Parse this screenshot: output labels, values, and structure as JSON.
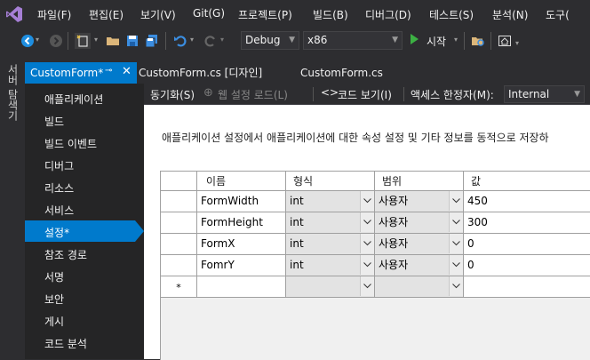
{
  "menu": [
    "파일(F)",
    "편집(E)",
    "보기(V)",
    "Git(G)",
    "프로젝트(P)",
    "빌드(B)",
    "디버그(D)",
    "테스트(S)",
    "분석(N)",
    "도구("
  ],
  "toolbar": {
    "config": "Debug",
    "platform": "x86",
    "start_label": "시작"
  },
  "server_explorer": "서버 탐색기",
  "tabs": {
    "active": "CustomForm*",
    "designer": "CustomForm.cs [디자인]",
    "code": "CustomForm.cs"
  },
  "nav": [
    "애플리케이션",
    "빌드",
    "빌드 이벤트",
    "디버그",
    "리소스",
    "서비스",
    "설정*",
    "참조 경로",
    "서명",
    "보안",
    "게시",
    "코드 분석"
  ],
  "designer_toolbar": {
    "sync": "동기화(S)",
    "load_web": "웹 설정 로드(L)",
    "view_code": "코드 보기(I)",
    "access_label": "액세스 한정자(M):",
    "access_value": "Internal"
  },
  "description": "애플리케이션 설정에서 애플리케이션에 대한 속성 설정 및 기타 정보를 동적으로 저장하",
  "grid": {
    "headers": [
      "이름",
      "형식",
      "범위",
      "값"
    ],
    "rows": [
      {
        "name": "FormWidth",
        "type": "int",
        "scope": "사용자",
        "value": "450"
      },
      {
        "name": "FormHeight",
        "type": "int",
        "scope": "사용자",
        "value": "300"
      },
      {
        "name": "FormX",
        "type": "int",
        "scope": "사용자",
        "value": "0"
      },
      {
        "name": "FomrY",
        "type": "int",
        "scope": "사용자",
        "value": "0"
      }
    ],
    "new_row_marker": "*"
  },
  "colors": {
    "accent": "#007acc",
    "chrome": "#2d2d30"
  }
}
